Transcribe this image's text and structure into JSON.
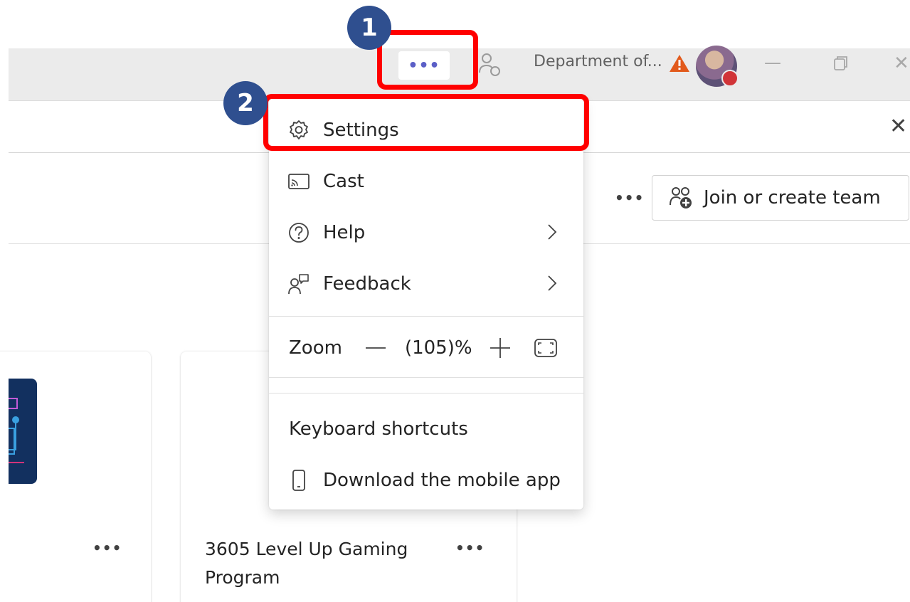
{
  "titlebar": {
    "more_label": "•••",
    "org_name": "Department of...",
    "minimize_label": "—",
    "close_label": "✕"
  },
  "subheader": {
    "close_label": "✕"
  },
  "teams_header": {
    "more_label": "•••",
    "join_create_label": "Join or create team"
  },
  "cards": [
    {
      "more_label": "•••"
    },
    {
      "title": "3605 Level Up Gaming Program",
      "more_label": "•••"
    }
  ],
  "menu": {
    "settings": "Settings",
    "cast": "Cast",
    "help": "Help",
    "feedback": "Feedback",
    "zoom": {
      "label": "Zoom",
      "value": "(105)%"
    },
    "keyboard_shortcuts": "Keyboard shortcuts",
    "download_mobile": "Download the mobile app"
  },
  "callouts": {
    "step1": "1",
    "step2": "2"
  },
  "colors": {
    "accent": "#5b5fc7",
    "highlight": "#ff0000",
    "badge": "#2f4f8f",
    "presence_busy": "#d13438",
    "warning": "#e25a1c"
  }
}
